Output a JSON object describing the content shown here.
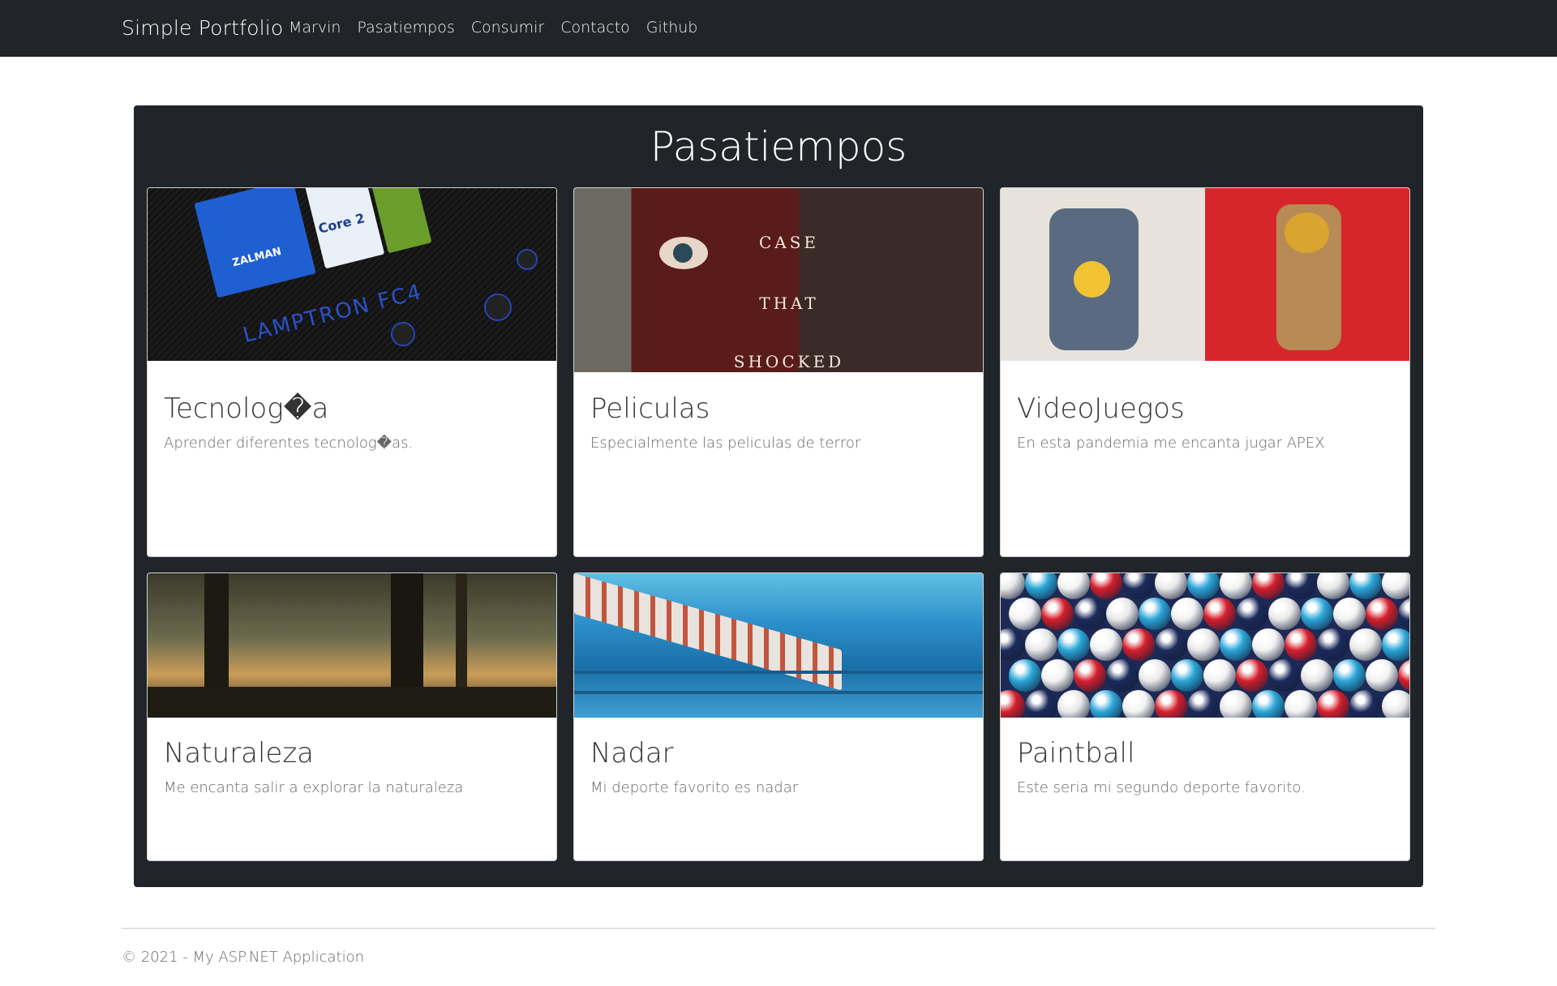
{
  "navbar": {
    "brand": "Simple Portfolio",
    "links": [
      "Marvin",
      "Pasatiempos",
      "Consumir",
      "Contacto",
      "Github"
    ]
  },
  "main": {
    "title": "Pasatiempos",
    "cards": [
      {
        "title": "Tecnolog�a",
        "text": "Aprender diferentes tecnolog�as.",
        "image": "computer-case-photo"
      },
      {
        "title": "Peliculas",
        "text": "Especialmente las peliculas de terror",
        "image": "horror-movie-poster"
      },
      {
        "title": "VideoJuegos",
        "text": "En esta pandemia me encanta jugar APEX",
        "image": "apex-legends-art"
      },
      {
        "title": "Naturaleza",
        "text": "Me encanta salir a explorar la naturaleza",
        "image": "forest-photo"
      },
      {
        "title": "Nadar",
        "text": "Mi deporte favorito es nadar",
        "image": "swimming-pool-photo"
      },
      {
        "title": "Paintball",
        "text": "Este seria mi segundo deporte favorito.",
        "image": "paintballs-photo"
      }
    ],
    "image_text": {
      "tech_brand": "ZALMAN",
      "tech_model": "LAMPTRON FC4",
      "tech_cpu": "Core 2",
      "movie_lines": [
        "CASE",
        "THAT",
        "SHOCKED"
      ]
    }
  },
  "footer": {
    "text": "© 2021 - My ASP.NET Application"
  },
  "colors": {
    "navbar_bg": "#212529",
    "panel_bg": "#212529",
    "card_bg": "#ffffff"
  }
}
